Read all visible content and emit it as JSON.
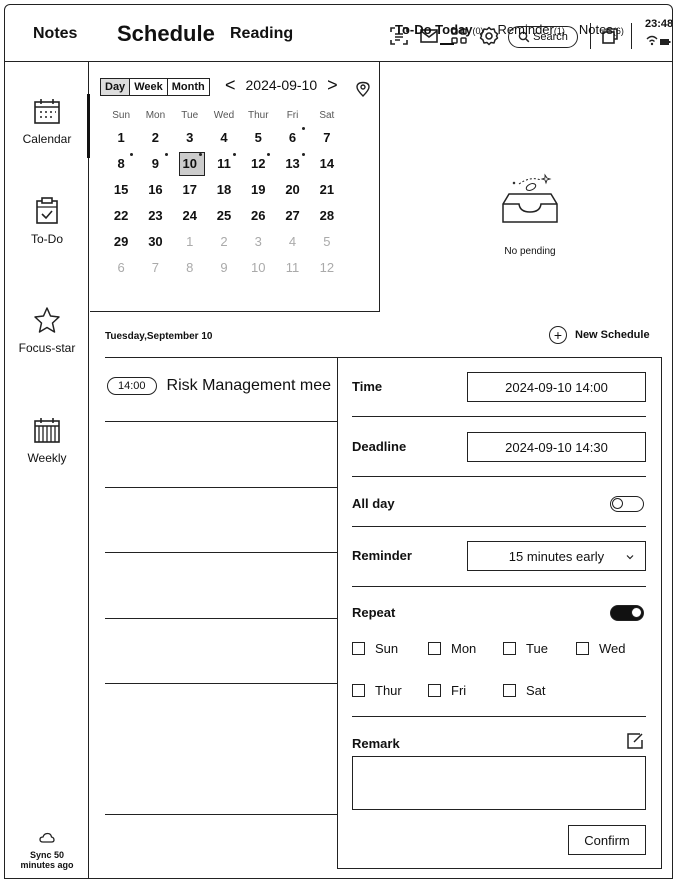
{
  "topbar": {
    "tabs": [
      "Notes",
      "Schedule",
      "Reading"
    ],
    "search_label": "Search",
    "time": "23:48"
  },
  "sidebar": {
    "items": [
      {
        "label": "Calendar",
        "icon": "calendar-icon"
      },
      {
        "label": "To-Do",
        "icon": "todo-clipboard-icon"
      },
      {
        "label": "Focus-star",
        "icon": "star-icon"
      },
      {
        "label": "Weekly",
        "icon": "weekly-calendar-icon"
      }
    ],
    "sync_line1": "Sync 50",
    "sync_line2": "minutes ago"
  },
  "calendar": {
    "view_tabs": [
      "Day",
      "Week",
      "Month"
    ],
    "current_date": "2024-09-10",
    "prev": "<",
    "next": ">",
    "weekdays": [
      "Sun",
      "Mon",
      "Tue",
      "Wed",
      "Thur",
      "Fri",
      "Sat"
    ],
    "weeks": [
      [
        {
          "d": "1"
        },
        {
          "d": "2"
        },
        {
          "d": "3"
        },
        {
          "d": "4"
        },
        {
          "d": "5"
        },
        {
          "d": "6",
          "dot": true
        },
        {
          "d": "7"
        }
      ],
      [
        {
          "d": "8",
          "dot": true
        },
        {
          "d": "9",
          "dot": true
        },
        {
          "d": "10",
          "sel": true,
          "dot": true
        },
        {
          "d": "11",
          "dot": true
        },
        {
          "d": "12",
          "dot": true
        },
        {
          "d": "13",
          "dot": true
        },
        {
          "d": "14"
        }
      ],
      [
        {
          "d": "15"
        },
        {
          "d": "16"
        },
        {
          "d": "17"
        },
        {
          "d": "18"
        },
        {
          "d": "19"
        },
        {
          "d": "20"
        },
        {
          "d": "21"
        }
      ],
      [
        {
          "d": "22"
        },
        {
          "d": "23"
        },
        {
          "d": "24"
        },
        {
          "d": "25"
        },
        {
          "d": "26"
        },
        {
          "d": "27"
        },
        {
          "d": "28"
        }
      ],
      [
        {
          "d": "29"
        },
        {
          "d": "30"
        },
        {
          "d": "1",
          "faded": true
        },
        {
          "d": "2",
          "faded": true
        },
        {
          "d": "3",
          "faded": true
        },
        {
          "d": "4",
          "faded": true
        },
        {
          "d": "5",
          "faded": true
        }
      ],
      [
        {
          "d": "6",
          "faded": true
        },
        {
          "d": "7",
          "faded": true
        },
        {
          "d": "8",
          "faded": true
        },
        {
          "d": "9",
          "faded": true
        },
        {
          "d": "10",
          "faded": true
        },
        {
          "d": "11",
          "faded": true
        },
        {
          "d": "12",
          "faded": true
        }
      ]
    ]
  },
  "right_tabs": {
    "todo_label": "To-Do Today",
    "todo_count": "(0)",
    "reminder_label": "Reminder",
    "reminder_count": "(1)",
    "notes_label": "Notes",
    "notes_count": "(6)",
    "empty_text": "No pending"
  },
  "schedule": {
    "day_title": "Tuesday,September 10",
    "new_schedule": "New Schedule",
    "event_time": "14:00",
    "event_title": "Risk Management mee"
  },
  "panel": {
    "time_label": "Time",
    "time_value": "2024-09-10 14:00",
    "deadline_label": "Deadline",
    "deadline_value": "2024-09-10 14:30",
    "allday_label": "All day",
    "allday_on": false,
    "reminder_label": "Reminder",
    "reminder_value": "15 minutes early",
    "repeat_label": "Repeat",
    "repeat_on": true,
    "repeat_days": [
      "Sun",
      "Mon",
      "Tue",
      "Wed",
      "Thur",
      "Fri",
      "Sat"
    ],
    "remark_label": "Remark",
    "remark_value": "",
    "confirm_label": "Confirm"
  }
}
